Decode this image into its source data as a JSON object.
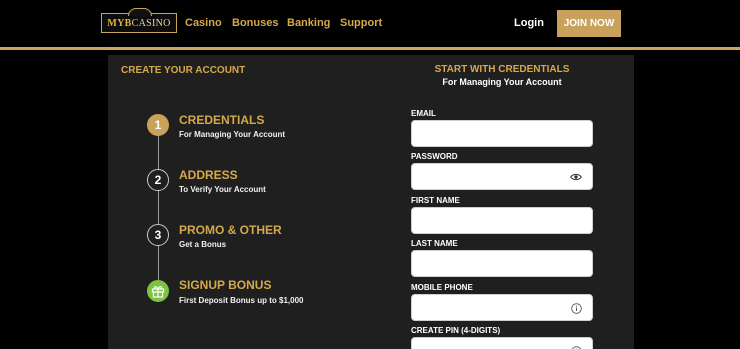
{
  "header": {
    "logo": {
      "prefix": "MYB",
      "suffix": "CASINO"
    },
    "nav": [
      {
        "label": "Casino"
      },
      {
        "label": "Bonuses"
      },
      {
        "label": "Banking"
      },
      {
        "label": "Support"
      }
    ],
    "login_label": "Login",
    "join_label": "JOIN NOW"
  },
  "left": {
    "heading": "CREATE YOUR ACCOUNT",
    "steps": [
      {
        "number": "1",
        "title": "CREDENTIALS",
        "subtitle": "For Managing Your Account",
        "state": "active"
      },
      {
        "number": "2",
        "title": "ADDRESS",
        "subtitle": "To Verify Your Account",
        "state": "pending"
      },
      {
        "number": "3",
        "title": "PROMO & OTHER",
        "subtitle": "Get a Bonus",
        "state": "pending"
      },
      {
        "number": "",
        "title": "SIGNUP BONUS",
        "subtitle": "First Deposit Bonus up to $1,000",
        "state": "gift",
        "icon": "gift-icon"
      }
    ]
  },
  "form": {
    "heading": "START WITH CREDENTIALS",
    "subheading": "For Managing Your Account",
    "fields": [
      {
        "label": "EMAIL",
        "value": "",
        "icon": ""
      },
      {
        "label": "PASSWORD",
        "value": "",
        "icon": "eye-icon"
      },
      {
        "label": "FIRST NAME",
        "value": "",
        "icon": ""
      },
      {
        "label": "LAST NAME",
        "value": "",
        "icon": ""
      },
      {
        "label": "MOBILE PHONE",
        "value": "",
        "icon": "info-icon"
      },
      {
        "label": "CREATE PIN (4-DIGITS)",
        "value": "",
        "icon": "info-icon"
      }
    ]
  },
  "colors": {
    "gold": "#c8a15a",
    "gold_text": "#d4a94a",
    "panel": "#1f1f1f",
    "gift_green": "#7cc243"
  }
}
